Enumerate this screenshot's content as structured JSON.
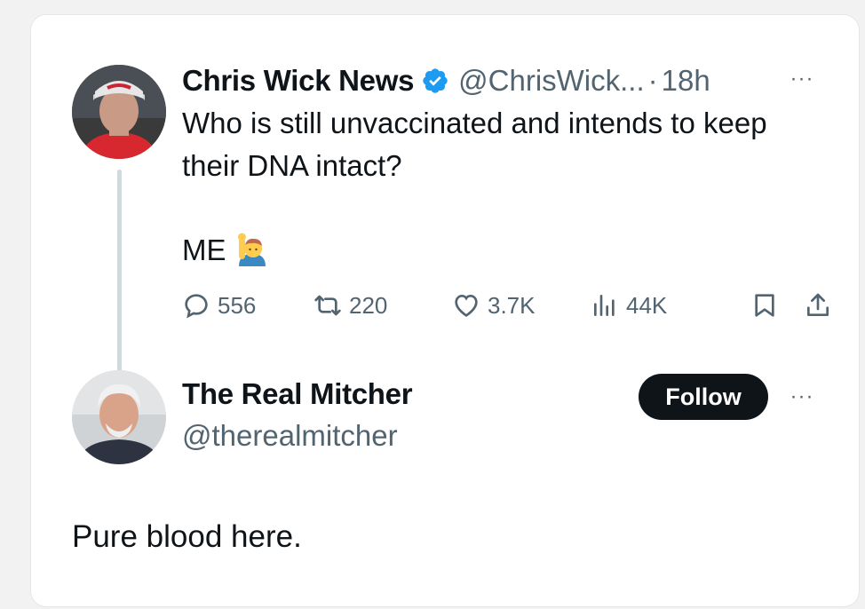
{
  "tweet": {
    "author_name": "Chris Wick News",
    "handle": "@ChrisWick...",
    "separator": "·",
    "time": "18h",
    "more_label": "···",
    "text": "Who is still unvaccinated and intends to keep their DNA intact?",
    "me_text": "ME",
    "emoji_icon": "person-raising-hand-icon",
    "stats": {
      "replies": "556",
      "retweets": "220",
      "likes": "3.7K",
      "views": "44K"
    }
  },
  "reply": {
    "author_name": "The Real Mitcher",
    "handle": "@therealmitcher",
    "follow_label": "Follow",
    "more_label": "···",
    "text": "Pure blood here."
  },
  "colors": {
    "verified_blue": "#1d9bf0",
    "secondary_text": "#536471",
    "primary_text": "#0f1419",
    "thread_line": "#cfd9de"
  }
}
